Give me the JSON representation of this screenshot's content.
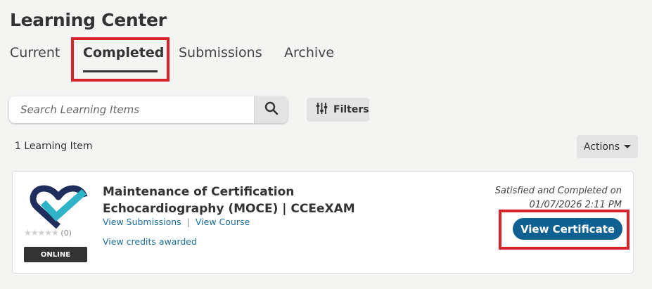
{
  "header": {
    "title": "Learning Center"
  },
  "tabs": [
    {
      "label": "Current"
    },
    {
      "label": "Completed",
      "active": true
    },
    {
      "label": "Submissions"
    },
    {
      "label": "Archive"
    }
  ],
  "search": {
    "placeholder": "Search Learning Items",
    "value": "",
    "icon": "search-icon"
  },
  "filters": {
    "label": "Filters",
    "icon": "sliders-icon"
  },
  "results": {
    "count_label": "1 Learning Item"
  },
  "actions": {
    "label": "Actions"
  },
  "items": [
    {
      "title": "Maintenance of Certification Echocardiography (MOCE) | CCEeXAM",
      "rating_count": "(0)",
      "rating_stars": 0,
      "type_badge": "ONLINE",
      "links": [
        "View Submissions",
        "View Course"
      ],
      "credits_link": "View credits awarded",
      "status_line1": "Satisfied and Completed on",
      "status_line2": "01/07/2026 2:11 PM",
      "action_label": "View Certificate"
    }
  ],
  "colors": {
    "accent": "#0f6192",
    "highlight": "#d9232a",
    "link": "#1b6d9a",
    "logo_navy": "#1f2d5c",
    "logo_teal": "#2eb4c6"
  }
}
